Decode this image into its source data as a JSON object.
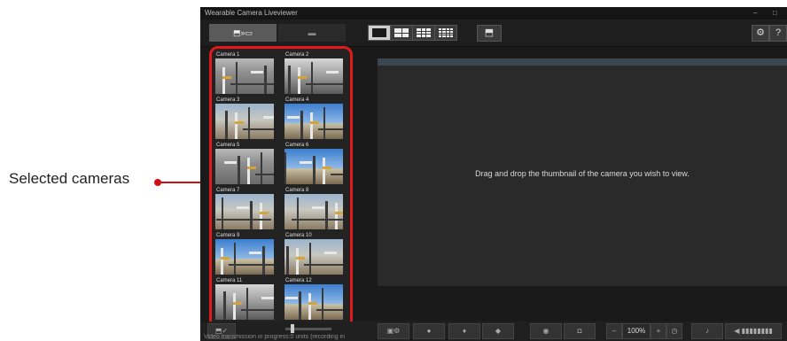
{
  "annotation": {
    "label": "Selected cameras",
    "color": "#d01010"
  },
  "window": {
    "title": "Wearable Camera Liveviewer",
    "minimize": "–",
    "maximize": "□"
  },
  "tabs": [
    {
      "icon": "camera-to-monitor-icon",
      "glyph": "⬒»▭"
    },
    {
      "icon": "folder-icon",
      "glyph": "▬"
    }
  ],
  "layout_buttons": [
    "1x1",
    "2x2",
    "3x3",
    "4x4"
  ],
  "toolbar_icons": {
    "switch": "⬒",
    "settings": "⚙",
    "help": "?"
  },
  "cameras": [
    {
      "label": "Camera 1",
      "style": "t-ind"
    },
    {
      "label": "Camera 2",
      "style": "t-ind2"
    },
    {
      "label": "Camera 3",
      "style": "t-site"
    },
    {
      "label": "Camera 4",
      "style": "t-sky"
    },
    {
      "label": "Camera 5",
      "style": "t-ind"
    },
    {
      "label": "Camera 6",
      "style": "t-sky"
    },
    {
      "label": "Camera 7",
      "style": "t-site"
    },
    {
      "label": "Camera 8",
      "style": "t-site"
    },
    {
      "label": "Camera 9",
      "style": "t-sky"
    },
    {
      "label": "Camera 10",
      "style": "t-site"
    },
    {
      "label": "Camera 11",
      "style": "t-ind2"
    },
    {
      "label": "Camera 12",
      "style": "t-sky"
    }
  ],
  "viewer": {
    "message": "Drag and drop the thumbnail of the camera you wish to view."
  },
  "bottom": {
    "status": "Video transmission in progress:0 units (recording in",
    "check_btn": "⬒✓",
    "zoom": "100%",
    "zoom_minus": "–",
    "zoom_plus": "+",
    "volume": "◀ ▮▮▮▮▮▮▮▮"
  },
  "colors": {
    "accent_red": "#e01a1a",
    "panel_bg": "#232323",
    "app_bg": "#1a1a1a"
  }
}
